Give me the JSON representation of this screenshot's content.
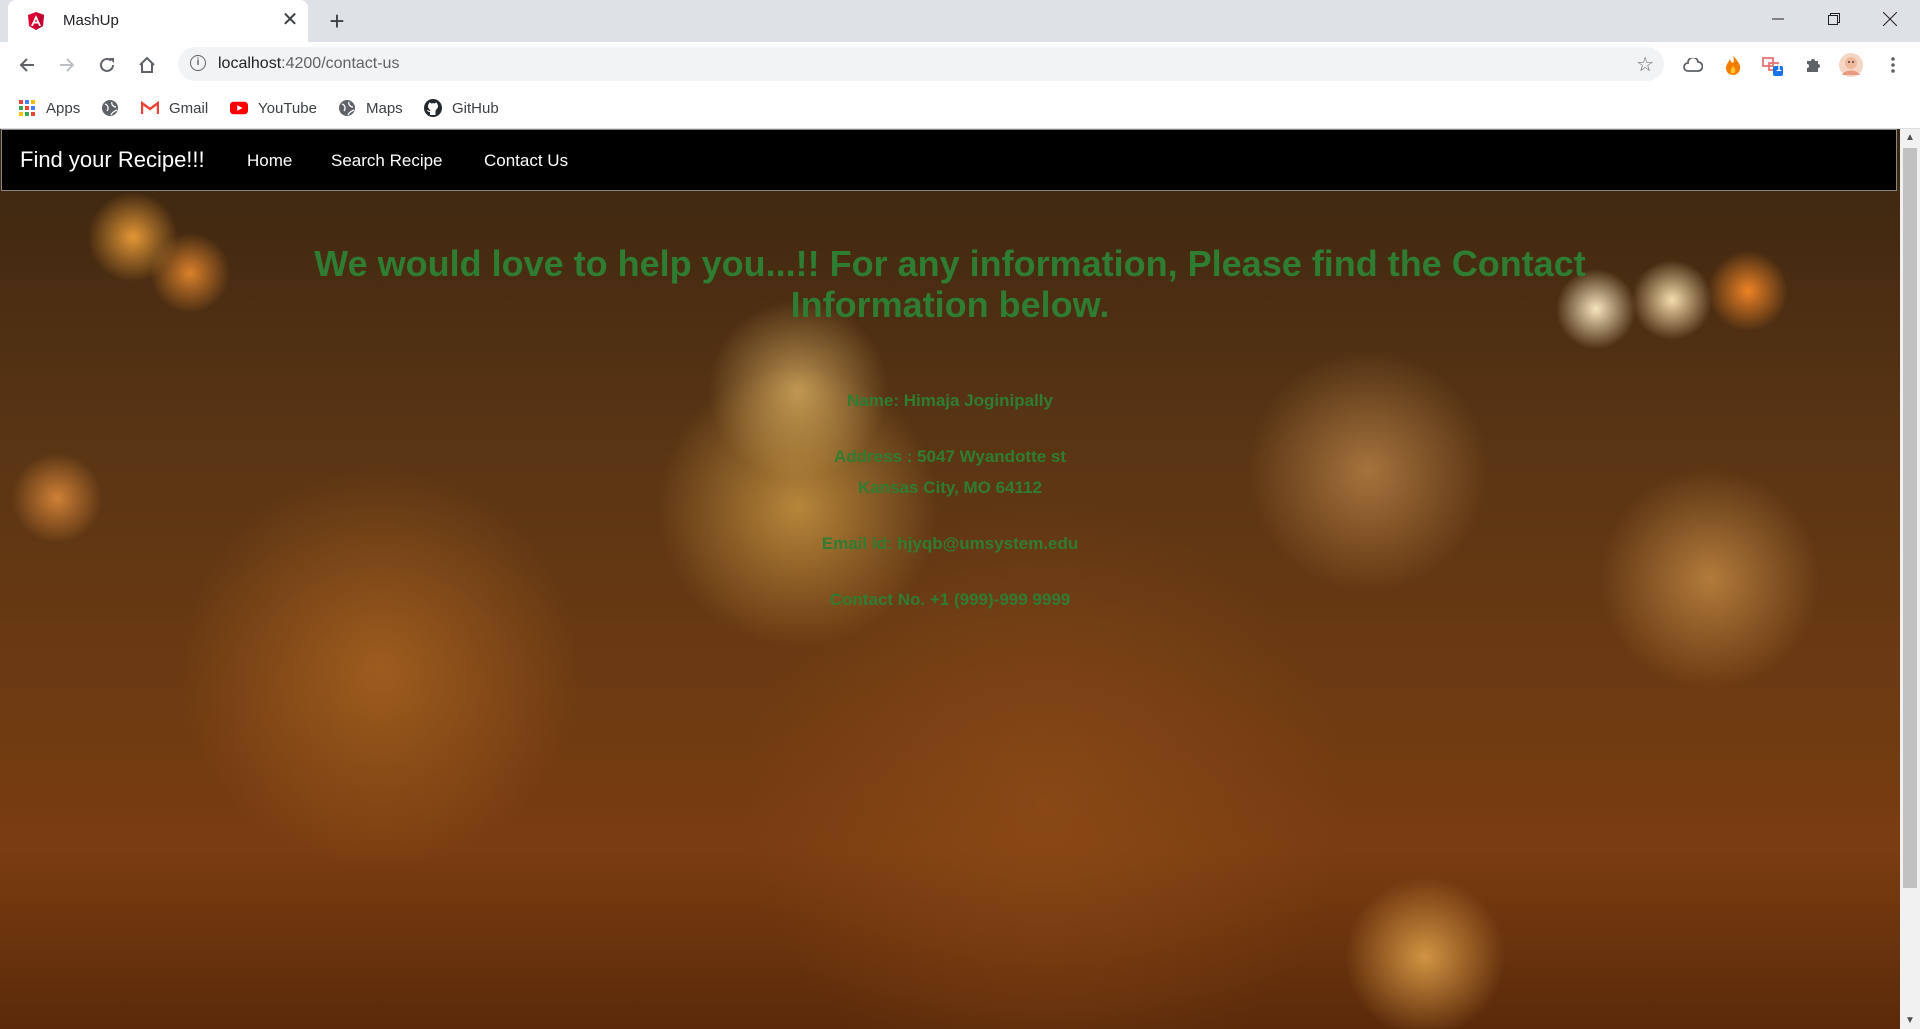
{
  "browser": {
    "tab_title": "MashUp",
    "new_tab_symbol": "+",
    "close_symbol": "✕",
    "url_host": "localhost",
    "url_path": ":4200/contact-us",
    "extension_badge": "1"
  },
  "bookmarks": [
    {
      "label": "Apps",
      "icon": "apps-grid-icon"
    },
    {
      "label": "",
      "icon": "globe-icon"
    },
    {
      "label": "Gmail",
      "icon": "gmail-icon"
    },
    {
      "label": "YouTube",
      "icon": "youtube-icon"
    },
    {
      "label": "Maps",
      "icon": "globe-icon"
    },
    {
      "label": "GitHub",
      "icon": "github-icon"
    }
  ],
  "navbar": {
    "brand": "Find your Recipe!!!",
    "links": [
      "Home",
      "Search Recipe",
      "Contact Us"
    ]
  },
  "contact": {
    "heading": "We would love to help you...!! For any information, Please find the Contact Information below.",
    "name": "Name: Himaja Joginipally",
    "address_line1": "Address : 5047 Wyandotte st",
    "address_line2": "Kansas City, MO 64112",
    "email": "Email id: hjyqb@umsystem.edu",
    "phone": "Contact No. +1 (999)-999 9999"
  },
  "colors": {
    "content_text": "#2e7d32",
    "navbar_bg": "#000000",
    "angular_red": "#dd0031"
  }
}
